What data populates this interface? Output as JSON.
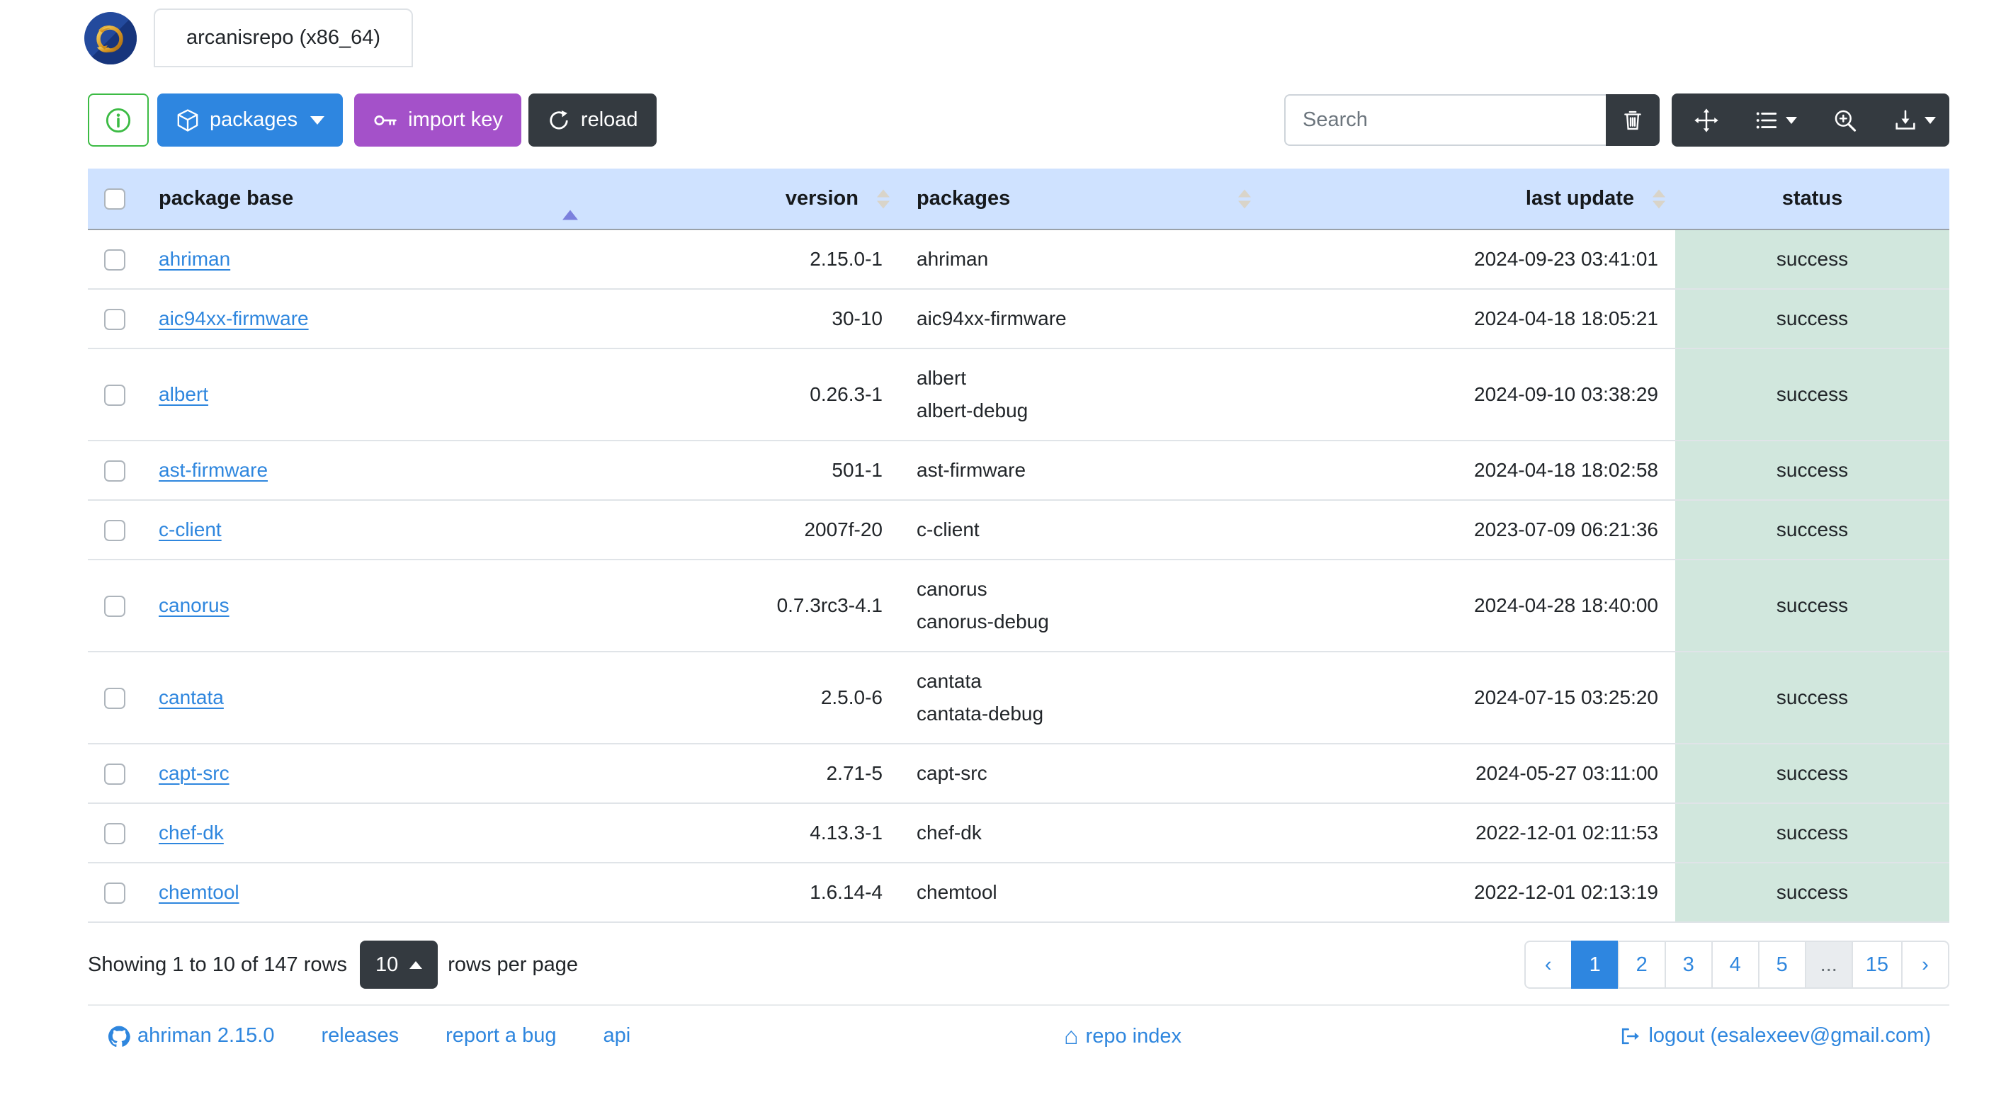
{
  "window": {
    "tab_label": "arcanisrepo (x86_64)",
    "logo": "ahriman-dragon-logo"
  },
  "toolbar": {
    "info_button": "info-circle-icon",
    "packages_label": "packages",
    "import_key_label": "import key",
    "reload_label": "reload",
    "search_placeholder": "Search",
    "icon_buttons": [
      "trash-icon",
      "arrows-move-icon",
      "columns-list-icon",
      "zoom-in-icon",
      "download-icon"
    ]
  },
  "table": {
    "columns": [
      "package base",
      "version",
      "packages",
      "last update",
      "status"
    ],
    "sorted_column": "package base",
    "sort_direction": "asc",
    "rows": [
      {
        "base": "ahriman",
        "version": "2.15.0-1",
        "packages": "ahriman",
        "last_update": "2024-09-23 03:41:01",
        "status": "success"
      },
      {
        "base": "aic94xx-firmware",
        "version": "30-10",
        "packages": "aic94xx-firmware",
        "last_update": "2024-04-18 18:05:21",
        "status": "success"
      },
      {
        "base": "albert",
        "version": "0.26.3-1",
        "packages": "albert\nalbert-debug",
        "last_update": "2024-09-10 03:38:29",
        "status": "success"
      },
      {
        "base": "ast-firmware",
        "version": "501-1",
        "packages": "ast-firmware",
        "last_update": "2024-04-18 18:02:58",
        "status": "success"
      },
      {
        "base": "c-client",
        "version": "2007f-20",
        "packages": "c-client",
        "last_update": "2023-07-09 06:21:36",
        "status": "success"
      },
      {
        "base": "canorus",
        "version": "0.7.3rc3-4.1",
        "packages": "canorus\ncanorus-debug",
        "last_update": "2024-04-28 18:40:00",
        "status": "success"
      },
      {
        "base": "cantata",
        "version": "2.5.0-6",
        "packages": "cantata\ncantata-debug",
        "last_update": "2024-07-15 03:25:20",
        "status": "success"
      },
      {
        "base": "capt-src",
        "version": "2.71-5",
        "packages": "capt-src",
        "last_update": "2024-05-27 03:11:00",
        "status": "success"
      },
      {
        "base": "chef-dk",
        "version": "4.13.3-1",
        "packages": "chef-dk",
        "last_update": "2022-12-01 02:11:53",
        "status": "success"
      },
      {
        "base": "chemtool",
        "version": "1.6.14-4",
        "packages": "chemtool",
        "last_update": "2022-12-01 02:13:19",
        "status": "success"
      }
    ]
  },
  "pagination": {
    "summary": "Showing 1 to 10 of 147 rows",
    "rows_per_page_value": "10",
    "rows_per_page_label": "rows per page",
    "prev": "‹",
    "next": "›",
    "pages": [
      "1",
      "2",
      "3",
      "4",
      "5",
      "...",
      "15"
    ],
    "active_page": "1"
  },
  "footer": {
    "version_link": "ahriman 2.15.0",
    "releases_link": "releases",
    "bug_link": "report a bug",
    "api_link": "api",
    "repo_index_link": "repo index",
    "home_glyph": "⌂",
    "logout_link": "logout (esalexeev@gmail.com)"
  },
  "colors": {
    "primary_blue": "#2e86e0",
    "link_blue": "#2e86de",
    "purple": "#a451c9",
    "dark": "#343a40",
    "green": "#3cbb44",
    "header_bg": "#cfe2ff",
    "success_bg": "#d1e7dd",
    "sort_active": "#7b80dd"
  }
}
